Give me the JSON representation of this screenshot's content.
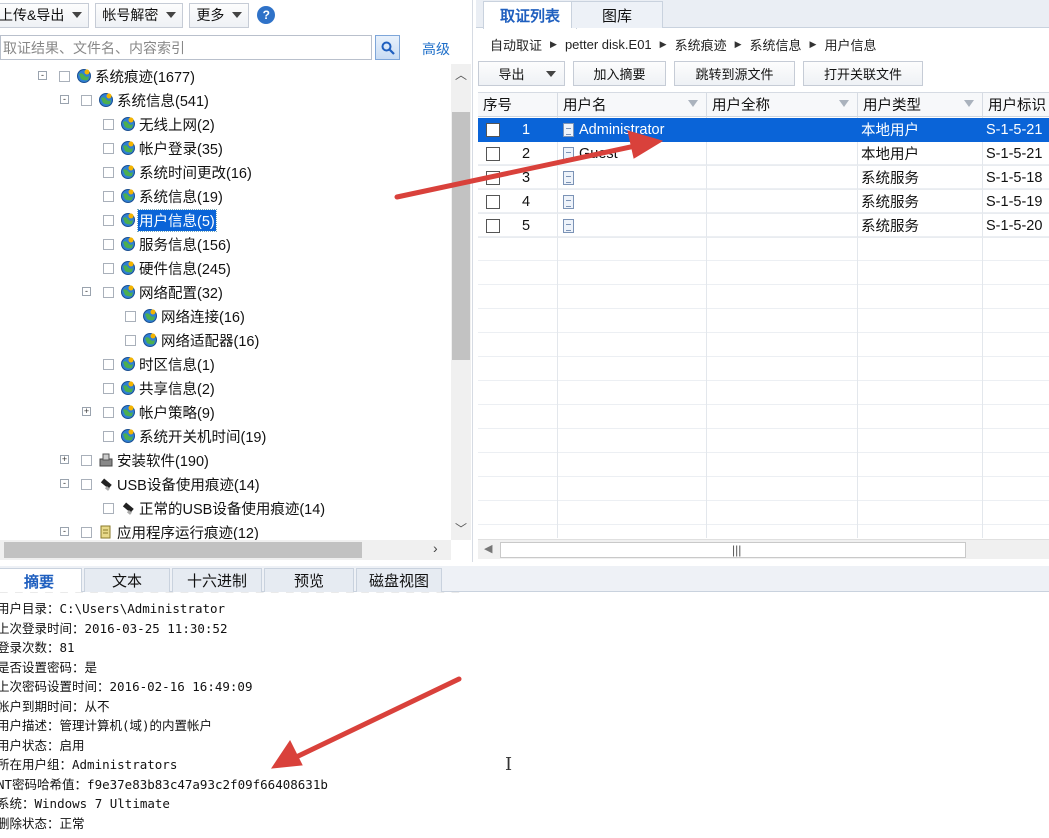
{
  "toolbar": {
    "export_menu": "上传&导出",
    "decrypt_menu": "帐号解密",
    "more_menu": "更多",
    "help": "?"
  },
  "search": {
    "placeholder": "取证结果、文件名、内容索引",
    "advanced": "高级"
  },
  "tree": [
    {
      "label": "系统痕迹(1677)",
      "expander": "-"
    },
    {
      "label": "系统信息(541)",
      "expander": "-"
    },
    {
      "label": "无线上网(2)"
    },
    {
      "label": "帐户登录(35)"
    },
    {
      "label": "系统时间更改(16)"
    },
    {
      "label": "系统信息(19)"
    },
    {
      "label": "用户信息(5)",
      "selected": true
    },
    {
      "label": "服务信息(156)"
    },
    {
      "label": "硬件信息(245)"
    },
    {
      "label": "网络配置(32)",
      "expander": "-"
    },
    {
      "label": "网络连接(16)"
    },
    {
      "label": "网络适配器(16)"
    },
    {
      "label": "时区信息(1)"
    },
    {
      "label": "共享信息(2)"
    },
    {
      "label": "帐户策略(9)",
      "expander": "+"
    },
    {
      "label": "系统开关机时间(19)"
    },
    {
      "label": "安装软件(190)",
      "expander": "+"
    },
    {
      "label": "USB设备使用痕迹(14)",
      "expander": "-"
    },
    {
      "label": "正常的USB设备使用痕迹(14)"
    },
    {
      "label": "应用程序运行痕迹(12)",
      "expander": "-"
    }
  ],
  "right_tabs": [
    "取证列表",
    "图库"
  ],
  "breadcrumb": [
    "自动取证",
    "petter disk.E01",
    "系统痕迹",
    "系统信息",
    "用户信息"
  ],
  "right_toolbar": {
    "export": "导出",
    "add_summary": "加入摘要",
    "jump_source": "跳转到源文件",
    "open_related": "打开关联文件"
  },
  "grid": {
    "columns": [
      "序号",
      "用户名",
      "用户全称",
      "用户类型",
      "用户标识"
    ],
    "rows": [
      {
        "index": "1",
        "name": "Administrator",
        "fullname": "",
        "type": "本地用户",
        "sid": "S-1-5-21",
        "selected": true
      },
      {
        "index": "2",
        "name": "Guest",
        "fullname": "",
        "type": "本地用户",
        "sid": "S-1-5-21"
      },
      {
        "index": "3",
        "name": "",
        "fullname": "",
        "type": "系统服务",
        "sid": "S-1-5-18"
      },
      {
        "index": "4",
        "name": "",
        "fullname": "",
        "type": "系统服务",
        "sid": "S-1-5-19"
      },
      {
        "index": "5",
        "name": "",
        "fullname": "",
        "type": "系统服务",
        "sid": "S-1-5-20"
      }
    ]
  },
  "bottom_tabs": [
    "摘要",
    "文本",
    "十六进制",
    "预览",
    "磁盘视图"
  ],
  "detail_lines": [
    "用户目录：C:\\Users\\Administrator",
    "上次登录时间：2016-03-25 11:30:52",
    "登录次数：81",
    "是否设置密码：是",
    "上次密码设置时间：2016-02-16 16:49:09",
    "帐户到期时间：从不",
    "用户描述：管理计算机(域)的内置帐户",
    "用户状态：启用",
    "所在用户组：Administrators",
    "NT密码哈希值：f9e37e83b83c47a93c2f09f66408631b",
    "系统：Windows 7 Ultimate",
    "删除状态：正常"
  ],
  "colors": {
    "selection": "#0a64d8",
    "tab_active_text": "#1f5fbf",
    "annotation_arrow": "#d9413b"
  },
  "icons": {
    "tree_node": "globe-icon",
    "list_item": "document-icon",
    "search": "magnifier-icon"
  }
}
